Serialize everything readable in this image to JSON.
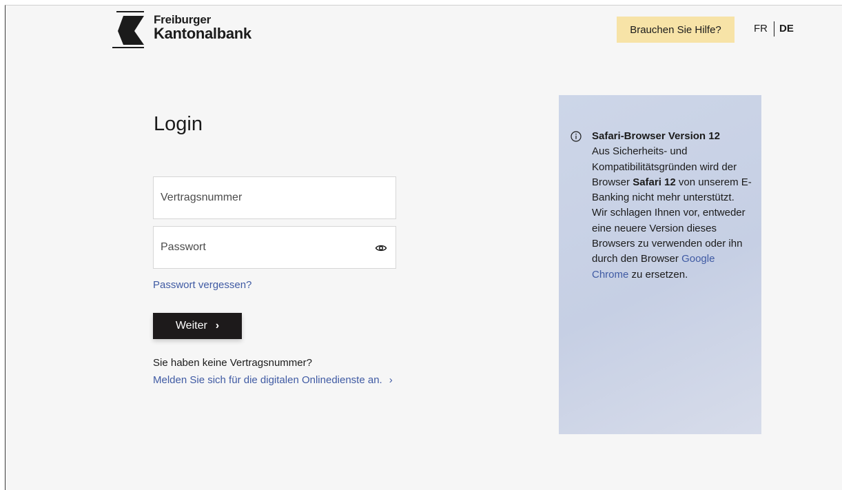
{
  "header": {
    "brand_line1": "Freiburger",
    "brand_line2": "Kantonalbank",
    "help_label": "Brauchen Sie Hilfe?",
    "lang_fr": "FR",
    "lang_de": "DE",
    "active_language": "DE"
  },
  "login": {
    "title": "Login",
    "contract_placeholder": "Vertragsnummer",
    "password_placeholder": "Passwort",
    "forgot_password": "Passwort vergessen?",
    "next_label": "Weiter",
    "no_contract_text": "Sie haben keine Vertragsnummer?",
    "register_link": "Melden Sie sich für die digitalen Onlinedienste an."
  },
  "info": {
    "heading": "Safari-Browser Version 12",
    "text_1": "Aus Sicherheits- und Kompatibilitätsgründen wird der Browser",
    "text_bold": "Safari 12",
    "text_2": "von unserem E-Banking nicht mehr unterstützt. Wir schlagen Ihnen vor, entweder eine neuere Version dieses Browsers zu verwenden oder ihn durch den Browser",
    "link": "Google Chrome",
    "text_3": "zu ersetzen."
  },
  "icons": {
    "logo": "fkb-logo-chevron",
    "eye": "eye-icon",
    "info": "info-icon",
    "chevron": "chevron-right-icon"
  },
  "colors": {
    "help_button_bg": "#f7e3a7",
    "primary_button_bg": "#1d1a1b",
    "link": "#3f5aa3",
    "info_panel_bg": "#c9d2e6",
    "page_bg": "#f6f6f6"
  }
}
